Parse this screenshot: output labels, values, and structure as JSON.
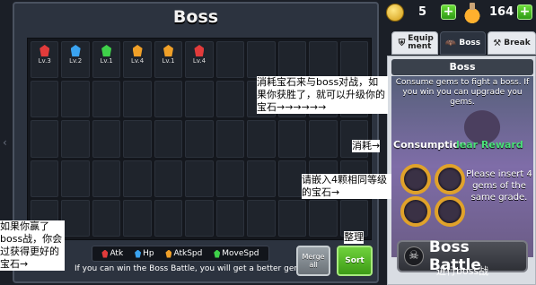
{
  "inventory": {
    "title": "Boss",
    "gems": [
      {
        "level": "Lv.3",
        "color": "#e23b3b"
      },
      {
        "level": "Lv.2",
        "color": "#3aa3f0"
      },
      {
        "level": "Lv.1",
        "color": "#3fd14a"
      },
      {
        "level": "Lv.4",
        "color": "#f0a028"
      },
      {
        "level": "Lv.1",
        "color": "#f0a028"
      },
      {
        "level": "Lv.4",
        "color": "#e23b3b"
      }
    ],
    "legend": [
      {
        "label": "Atk",
        "color": "#e23b3b"
      },
      {
        "label": "Hp",
        "color": "#3aa3f0"
      },
      {
        "label": "AtkSpd",
        "color": "#f0a028"
      },
      {
        "label": "MoveSpd",
        "color": "#3fd14a"
      }
    ],
    "hint": "If you can win the Boss Battle, you will get a better gem.",
    "merge_label": "Merge all",
    "sort_label": "Sort"
  },
  "currency": {
    "coins": "5",
    "potions": "164"
  },
  "tabs": [
    {
      "label": "Equip ment",
      "icon": "shield-icon",
      "active": false
    },
    {
      "label": "Boss",
      "icon": "bat-icon",
      "active": true
    },
    {
      "label": "Break",
      "icon": "hammer-icon",
      "active": false
    }
  ],
  "boss_panel": {
    "title": "Boss",
    "description": "Consume gems to fight a boss. If you win you can upgrade you gems.",
    "consumption_label": "Consumption",
    "clear_reward_label": "lear Reward",
    "insert_text": "Please insert 4 gems of the same grade.",
    "battle_label": "Boss Battle"
  },
  "annotations": {
    "desc_zh": "消耗宝石来与boss对战，如果你获胜了，就可以升级你的宝石→→→→→→",
    "consume_zh": "消耗→",
    "insert_zh": "请嵌入4颗相同等级的宝石→",
    "win_zh": "如果你赢了boss战，你会过获得更好的宝石→",
    "sort_zh": "整理",
    "battle_zh": "进行boss战"
  }
}
